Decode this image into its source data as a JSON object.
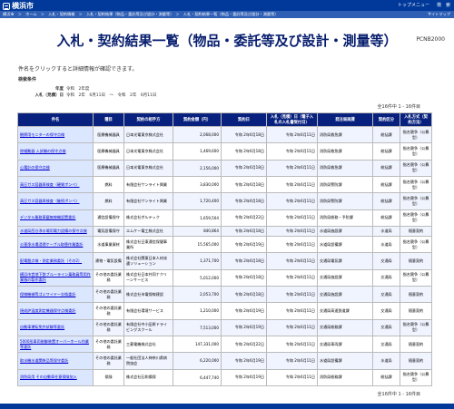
{
  "header": {
    "logo_text": "横浜市",
    "top_menu": "トップメニュー",
    "search": "検　索",
    "sitemap": "サイトマップ",
    "breadcrumb": "横浜市　＞　ホーム　＞　入札・契約情報　＞　入札・契約結果（物品・委託等及び設計・測量等）　＞　入札・契約結果一覧（物品・委託等及び設計・測量等）"
  },
  "page": {
    "title": "入札・契約結果一覧（物品・委託等及び設計・測量等）",
    "code": "PCNB2000",
    "lead": "件名をクリックすると詳細情報が確認できます。",
    "conditions_title": "検索条件",
    "fy_label": "年度",
    "fy_value": "令和　2年度",
    "date_label": "入札（見積）日",
    "date_value": "令和　2年　6月11日　～　令和　2年　6月11日",
    "count_top": "全16件中 1 - 16件目",
    "count_bottom": "全16件中 1 - 16件目"
  },
  "table": {
    "headers": [
      "件名",
      "種目",
      "契約の相手方",
      "契約金額（円）",
      "契約日",
      "入札（見積）日（電子入札の入札書受付日）",
      "発注局局課",
      "契約区分",
      "入札方式（契約方法）"
    ],
    "rows": [
      [
        "観察用モニターの保守点検",
        "医療機械器具",
        "日本光電東京株式会社",
        "2,068,000",
        "令和 2年6月18日",
        "令和 2年6月11日",
        "消防局救急課",
        "総括課",
        "指名競争（公募型）"
      ],
      [
        "除細動器 入試機の保守点検",
        "医療機械器具",
        "日本光電東京株式会社",
        "1,469,600",
        "令和 2年6月18日",
        "令和 2年6月11日",
        "消防局救急課",
        "総括課",
        "指名競争（公募型）"
      ],
      [
        "心電計の保守点検",
        "医療機械器具",
        "日本光電東京株式会社",
        "2,156,000",
        "令和 2年6月18日",
        "令和 2年6月11日",
        "消防局救急課",
        "総括課",
        "指名競争（公募型）"
      ],
      [
        "高圧ガス容器再検査（硬質ボンベ）",
        "燃料",
        "有限会社サンライト興業",
        "3,830,000",
        "令和 2年6月18日",
        "令和 2年6月11日",
        "消防局警防課",
        "総括課",
        "指名競争（公募型）"
      ],
      [
        "高圧ガス容器再検査（継続ボンベ）",
        "燃料",
        "有限会社サンライト興業",
        "1,720,400",
        "令和 2年6月18日",
        "令和 2年6月11日",
        "消防局警防課",
        "総括課",
        "指名競争（公募型）"
      ],
      [
        "デジタル業務車載無線機設置委託",
        "通信設備保守",
        "株式会社ボルテック",
        "1,659,504",
        "令和 2年6月22日",
        "令和 2年6月11日",
        "消防局総務・予防課",
        "総括課",
        "指名競争（公募型）"
      ],
      [
        "水道局西谷浄水場用電力設備の保守点検",
        "電気設備保守",
        "エムケー電工株式会社",
        "840,864",
        "令和 2年6月18日",
        "令和 2年6月11日",
        "水道局施設課",
        "水道局",
        "随意契約"
      ],
      [
        "公害浄水場浸透ケーブル取替作業委託",
        "水道事業資材",
        "株式会社日東通信保健事業所",
        "15,565,000",
        "令和 2年6月19日",
        "令和 2年6月11日",
        "水道局設備課",
        "水道局",
        "指名競争（公募型）"
      ],
      [
        "配電盤点検・測定業務委託（その2）",
        "建物・電気設備",
        "株式会社関東日本人材派遣ソリューション",
        "1,371,700",
        "令和 2年6月18日",
        "令和 2年6月11日",
        "交通局電気課",
        "交通局",
        "随意契約"
      ],
      [
        "横浜市営地下鉄ブルーライン乗務員等用作業服の製作委託",
        "その他の委託業務",
        "株式会社日本共同ナクリーンサービス",
        "5,012,000",
        "令和 2年6月18日",
        "令和 2年6月11日",
        "交通局施設課",
        "交通局",
        "指名競争（公募型）"
      ],
      [
        "保線機械等ゴミワイヤー交換委託",
        "その他の委託業務",
        "株式会社市電保線建設",
        "2,053,700",
        "令和 2年6月18日",
        "令和 2年6月11日",
        "交通局施設課",
        "交通局",
        "随意契約"
      ],
      [
        "焼成炉温度測定機器保守点検委託",
        "その他の委託業務",
        "有限会社環境サービス",
        "1,210,000",
        "令和 2年6月19日",
        "令和 2年6月11日",
        "交通局高速鉄道課",
        "交通局",
        "随意契約"
      ],
      [
        "自動車運転免許試験等委託",
        "その他の委託業務",
        "有限会社中小田原ドライビングスクール",
        "7,513,000",
        "令和 2年6月19日",
        "令和 2年6月11日",
        "交通局総務課",
        "交通局",
        "指名競争（公募型）"
      ],
      [
        "5000形車両制御装置オーバーホール作業等委託",
        "その他の委託業務",
        "三菱電機株式会社",
        "147,331,000",
        "令和 2年6月22日",
        "令和 2年6月11日",
        "交通局車両課",
        "交通局",
        "随意契約"
      ],
      [
        "取水機水道関係品等保守委託",
        "その他の委託業務",
        "一般社団法人神奈川県病院協会",
        "6,220,000",
        "令和 2年6月19日",
        "令和 2年6月11日",
        "水道局設備課",
        "水道局",
        "随意契約"
      ],
      [
        "消防局用 その自動車任意保険加入",
        "保険",
        "株式会社石和損保",
        "6,447,740",
        "令和 2年6月19日",
        "令和 2年6月11日",
        "消防局総務課",
        "総括課",
        "指名競争（公募型）"
      ]
    ]
  },
  "colors": {
    "brand_blue": "#00399a",
    "header_blue": "#08217e"
  }
}
